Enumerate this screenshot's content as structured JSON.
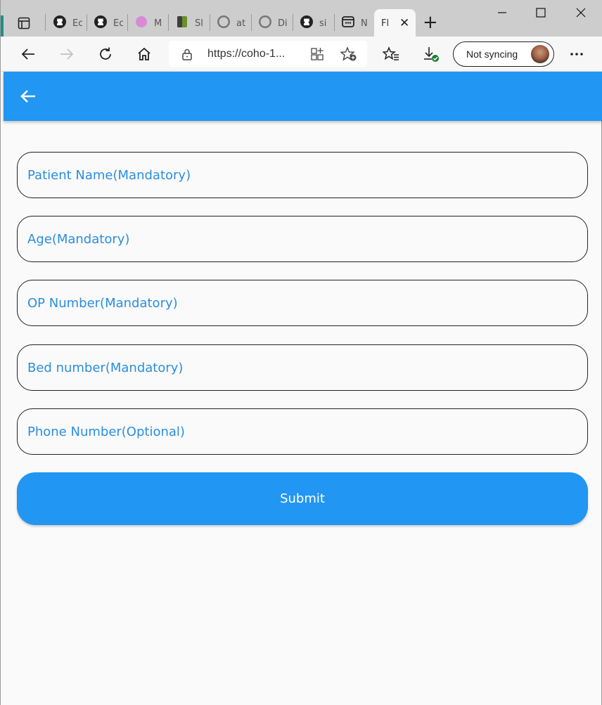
{
  "tabs": [
    {
      "label": "Ec",
      "icon": "github-icon"
    },
    {
      "label": "Ec",
      "icon": "github-icon"
    },
    {
      "label": "M",
      "icon": "circle-icon"
    },
    {
      "label": "Sl",
      "icon": "book-icon"
    },
    {
      "label": "at",
      "icon": "github-icon"
    },
    {
      "label": "Di",
      "icon": "github-icon"
    },
    {
      "label": "si",
      "icon": "github-icon"
    },
    {
      "label": "N",
      "icon": "app-icon"
    }
  ],
  "active_tab": {
    "label": "Fl"
  },
  "address": {
    "url": "https://coho-1..."
  },
  "sync": {
    "label": "Not syncing"
  },
  "form": {
    "patient_name_placeholder": "Patient Name(Mandatory)",
    "age_placeholder": "Age(Mandatory)",
    "op_number_placeholder": "OP Number(Mandatory)",
    "bed_number_placeholder": "Bed number(Mandatory)",
    "phone_placeholder": "Phone Number(Optional)",
    "submit_label": "Submit"
  },
  "colors": {
    "primary": "#2196f3",
    "background": "#fafafa"
  }
}
